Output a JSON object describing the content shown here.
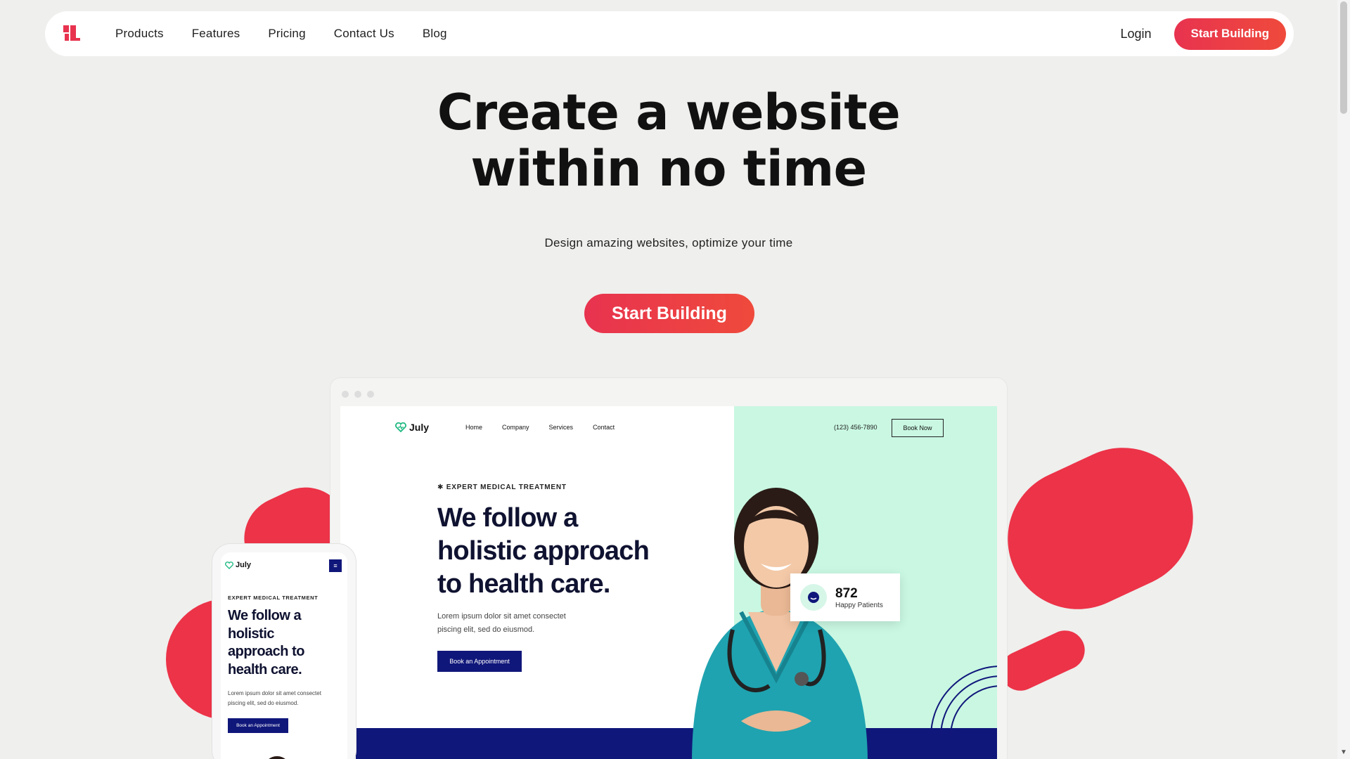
{
  "nav": {
    "logo_icon": "brand-logo-icon",
    "links": [
      "Products",
      "Features",
      "Pricing",
      "Contact Us",
      "Blog"
    ],
    "login_label": "Login",
    "cta_label": "Start Building"
  },
  "hero": {
    "title_line1": "Create a website",
    "title_line2": "within no time",
    "subtitle": "Design amazing websites, optimize your time",
    "cta_label": "Start Building"
  },
  "preview": {
    "brand": "July",
    "nav": [
      "Home",
      "Company",
      "Services",
      "Contact"
    ],
    "phone": "(123) 456-7890",
    "book_now": "Book Now",
    "eyebrow": "EXPERT MEDICAL TREATMENT",
    "headline_lines": [
      "We follow a",
      "holistic approach",
      "to health care."
    ],
    "body_lines": [
      "Lorem ipsum dolor sit amet consectet",
      "piscing elit, sed do eiusmod."
    ],
    "appointment_label": "Book an Appointment",
    "stat_value": "872",
    "stat_label": "Happy Patients"
  },
  "mobile_preview": {
    "brand": "July",
    "eyebrow": "EXPERT MEDICAL TREATMENT",
    "headline_lines": [
      "We follow a",
      "holistic",
      "approach to",
      "health care."
    ],
    "body_lines": [
      "Lorem ipsum dolor sit amet consectet",
      "piscing elit, sed do eiusmod."
    ],
    "appointment_label": "Book an Appointment"
  },
  "colors": {
    "accent_red": "#ec3348",
    "navy": "#10177a",
    "mint": "#c9f7e2",
    "page_bg": "#efefed"
  }
}
